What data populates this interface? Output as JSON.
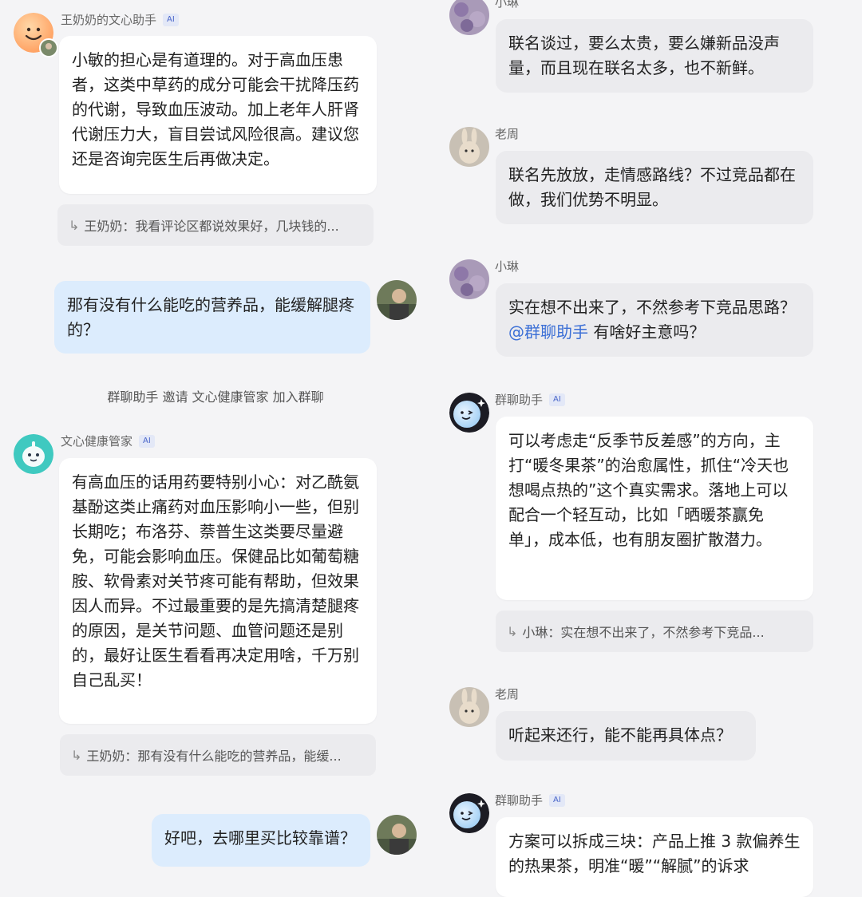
{
  "left": {
    "msg1": {
      "sender": "王奶奶的文心助手",
      "ai_badge": "AI",
      "text": "小敏的担心是有道理的。对于高血压患者，这类中草药的成分可能会干扰降压药的代谢，导致血压波动。加上老年人肝肾代谢压力大，盲目尝试风险很高。建议您还是咨询完医生后再做决定。",
      "quote": "王奶奶：我看评论区都说效果好，几块钱的..."
    },
    "msg2": {
      "text": "那有没有什么能吃的营养品，能缓解腿疼的？"
    },
    "system_notice": "群聊助手 邀请 文心健康管家 加入群聊",
    "msg3": {
      "sender": "文心健康管家",
      "ai_badge": "AI",
      "text": "有高血压的话用药要特别小心：对乙酰氨基酚这类止痛药对血压影响小一些，但别长期吃；布洛芬、萘普生这类要尽量避免，可能会影响血压。保健品比如葡萄糖胺、软骨素对关节疼可能有帮助，但效果因人而异。不过最重要的是先搞清楚腿疼的原因，是关节问题、血管问题还是别的，最好让医生看看再决定用啥，千万别自己乱买！",
      "quote": "王奶奶：那有没有什么能吃的营养品，能缓..."
    },
    "msg4": {
      "text": "好吧，去哪里买比较靠谱？"
    }
  },
  "right": {
    "msg1": {
      "sender": "小琳",
      "text": "联名谈过，要么太贵，要么嫌新品没声量，而且现在联名太多，也不新鲜。"
    },
    "msg2": {
      "sender": "老周",
      "text": "联名先放放，走情感路线？不过竞品都在做，我们优势不明显。"
    },
    "msg3": {
      "sender": "小琳",
      "text_before": "实在想不出来了，不然参考下竞品思路？",
      "mention": "@群聊助手",
      "text_after": " 有啥好主意吗？"
    },
    "msg4": {
      "sender": "群聊助手",
      "ai_badge": "AI",
      "text": "可以考虑走“反季节反差感”的方向，主打“暖冬果茶”的治愈属性，抓住“冷天也想喝点热的”这个真实需求。落地上可以配合一个轻互动，比如「晒暖茶赢免单」，成本低，也有朋友圈扩散潜力。",
      "quote": "小琳：实在想不出来了，不然参考下竞品..."
    },
    "msg5": {
      "sender": "老周",
      "text": "听起来还行，能不能再具体点？"
    },
    "msg6": {
      "sender": "群聊助手",
      "ai_badge": "AI",
      "text": "方案可以拆成三块：产品上推 3 款偏养生的热果茶，明准“暖”“解腻”的诉求"
    }
  },
  "colors": {
    "blue_bubble": "#dcecfd",
    "grey_bubble": "#ebebee",
    "mention": "#3b6fd6",
    "ai_badge": "#4a66c9"
  },
  "icons": {
    "wenxin_assistant": "smiley-orange-avatar",
    "health_manager": "robot-mint-avatar",
    "group_assistant": "wink-face-avatar",
    "user_grandma": "photo-avatar",
    "xiaolin": "flower-photo-avatar",
    "laozhou": "rabbit-photo-avatar",
    "reply_arrow": "reply-arrow-icon"
  }
}
